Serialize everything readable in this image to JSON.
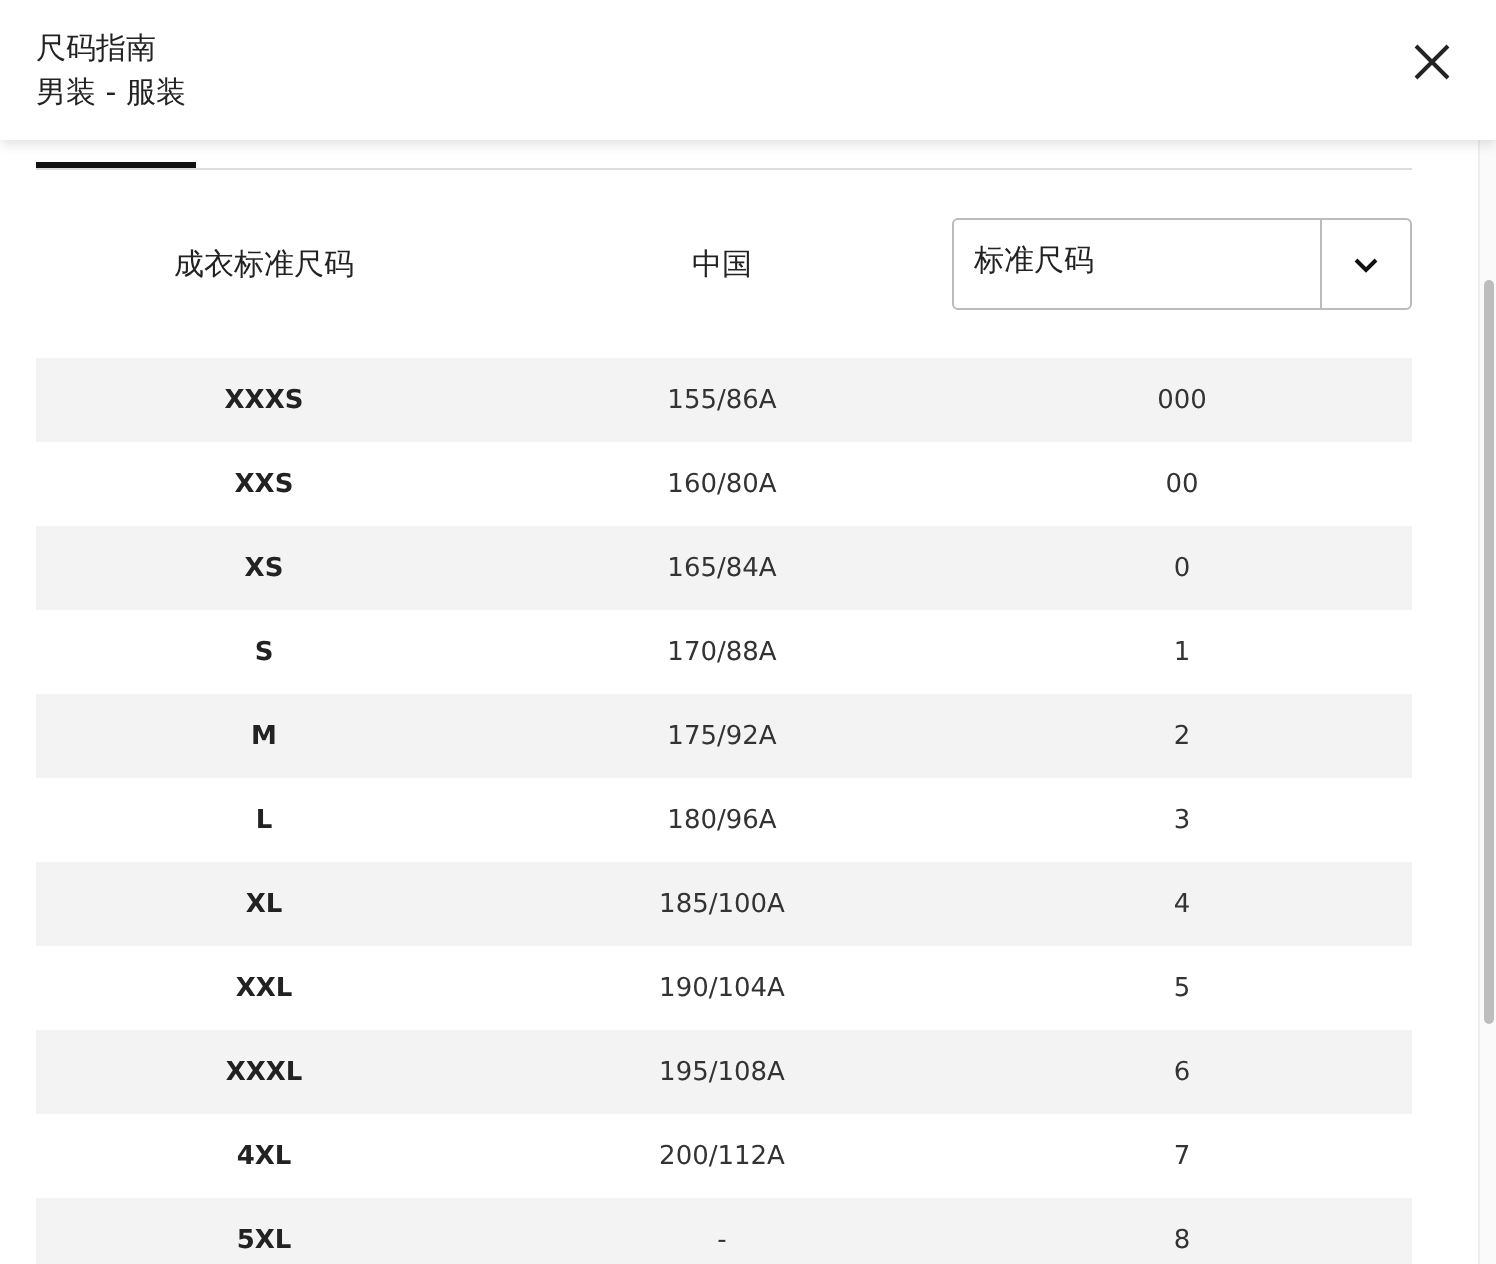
{
  "header": {
    "title": "尺码指南",
    "subtitle": "男装 - 服装"
  },
  "tabs": [
    {
      "selected": true
    }
  ],
  "table": {
    "columns": [
      "成衣标准尺码",
      "中国"
    ],
    "dropdown": {
      "value": "标准尺码"
    },
    "rows": [
      [
        "XXXS",
        "155/86A",
        "000"
      ],
      [
        "XXS",
        "160/80A",
        "00"
      ],
      [
        "XS",
        "165/84A",
        "0"
      ],
      [
        "S",
        "170/88A",
        "1"
      ],
      [
        "M",
        "175/92A",
        "2"
      ],
      [
        "L",
        "180/96A",
        "3"
      ],
      [
        "XL",
        "185/100A",
        "4"
      ],
      [
        "XXL",
        "190/104A",
        "5"
      ],
      [
        "XXXL",
        "195/108A",
        "6"
      ],
      [
        "4XL",
        "200/112A",
        "7"
      ],
      [
        "5XL",
        "-",
        "8"
      ]
    ]
  }
}
